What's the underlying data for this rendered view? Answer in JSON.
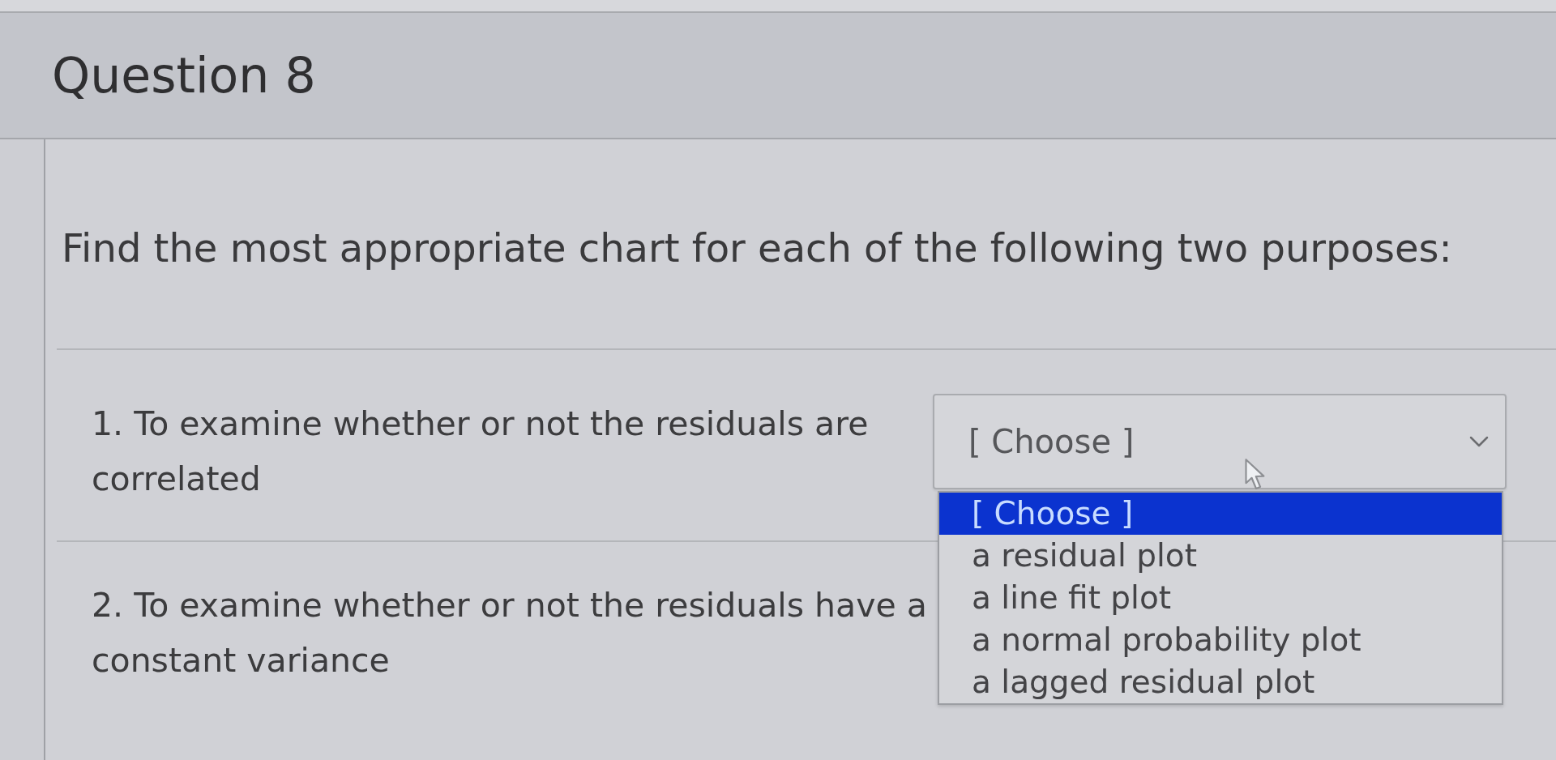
{
  "question": {
    "title": "Question 8"
  },
  "prompt": "Find the most appropriate chart for each of the following two purposes:",
  "matches": [
    {
      "label": "1. To examine whether or not the residuals are correlated",
      "answer": {
        "value": "[ Choose ]",
        "expanded": true,
        "options": [
          {
            "label": "[ Choose ]",
            "selected": true
          },
          {
            "label": "a residual plot",
            "selected": false
          },
          {
            "label": "a line fit plot",
            "selected": false
          },
          {
            "label": "a normal probability plot",
            "selected": false
          },
          {
            "label": "a lagged residual plot",
            "selected": false
          }
        ]
      }
    },
    {
      "label": "2. To examine whether or not the residuals have a constant variance"
    }
  ]
}
